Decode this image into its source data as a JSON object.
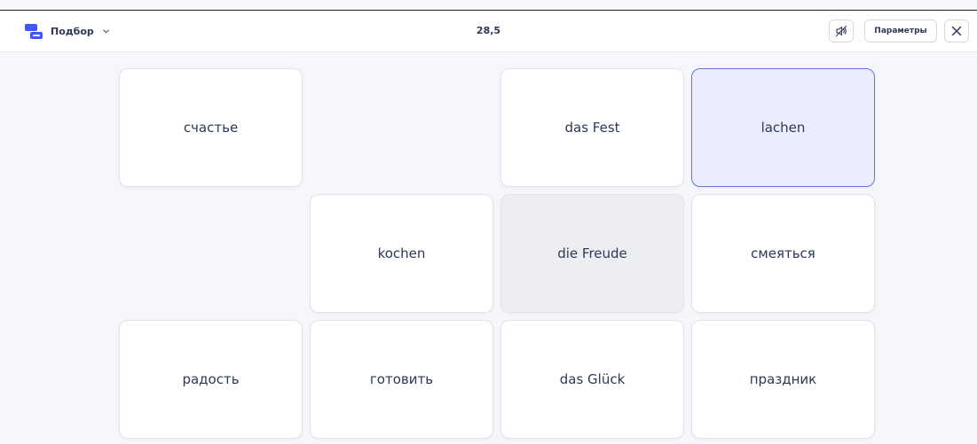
{
  "header": {
    "mode_label": "Подбор",
    "timer": "28,5",
    "settings_label": "Параметры",
    "sound_icon": "sound-off-icon",
    "close_icon": "close-icon",
    "mode_icon": "match-mode-icon"
  },
  "colors": {
    "brand_blue": "#4255ff",
    "selected_bg": "#ebedfd",
    "selected_border": "#6575d6",
    "text": "#2e3856"
  },
  "cards": {
    "schaste": "счастье",
    "das_fest": "das Fest",
    "lachen": "lachen",
    "kochen": "kochen",
    "die_freude": "die Freude",
    "smeyatsya": "смеяться",
    "radost": "радость",
    "gotovit": "готовить",
    "das_glueck": "das Glück",
    "prazdnik": "праздник"
  },
  "state": {
    "selected_card": "lachen",
    "dimmed_card": "die Freude"
  }
}
